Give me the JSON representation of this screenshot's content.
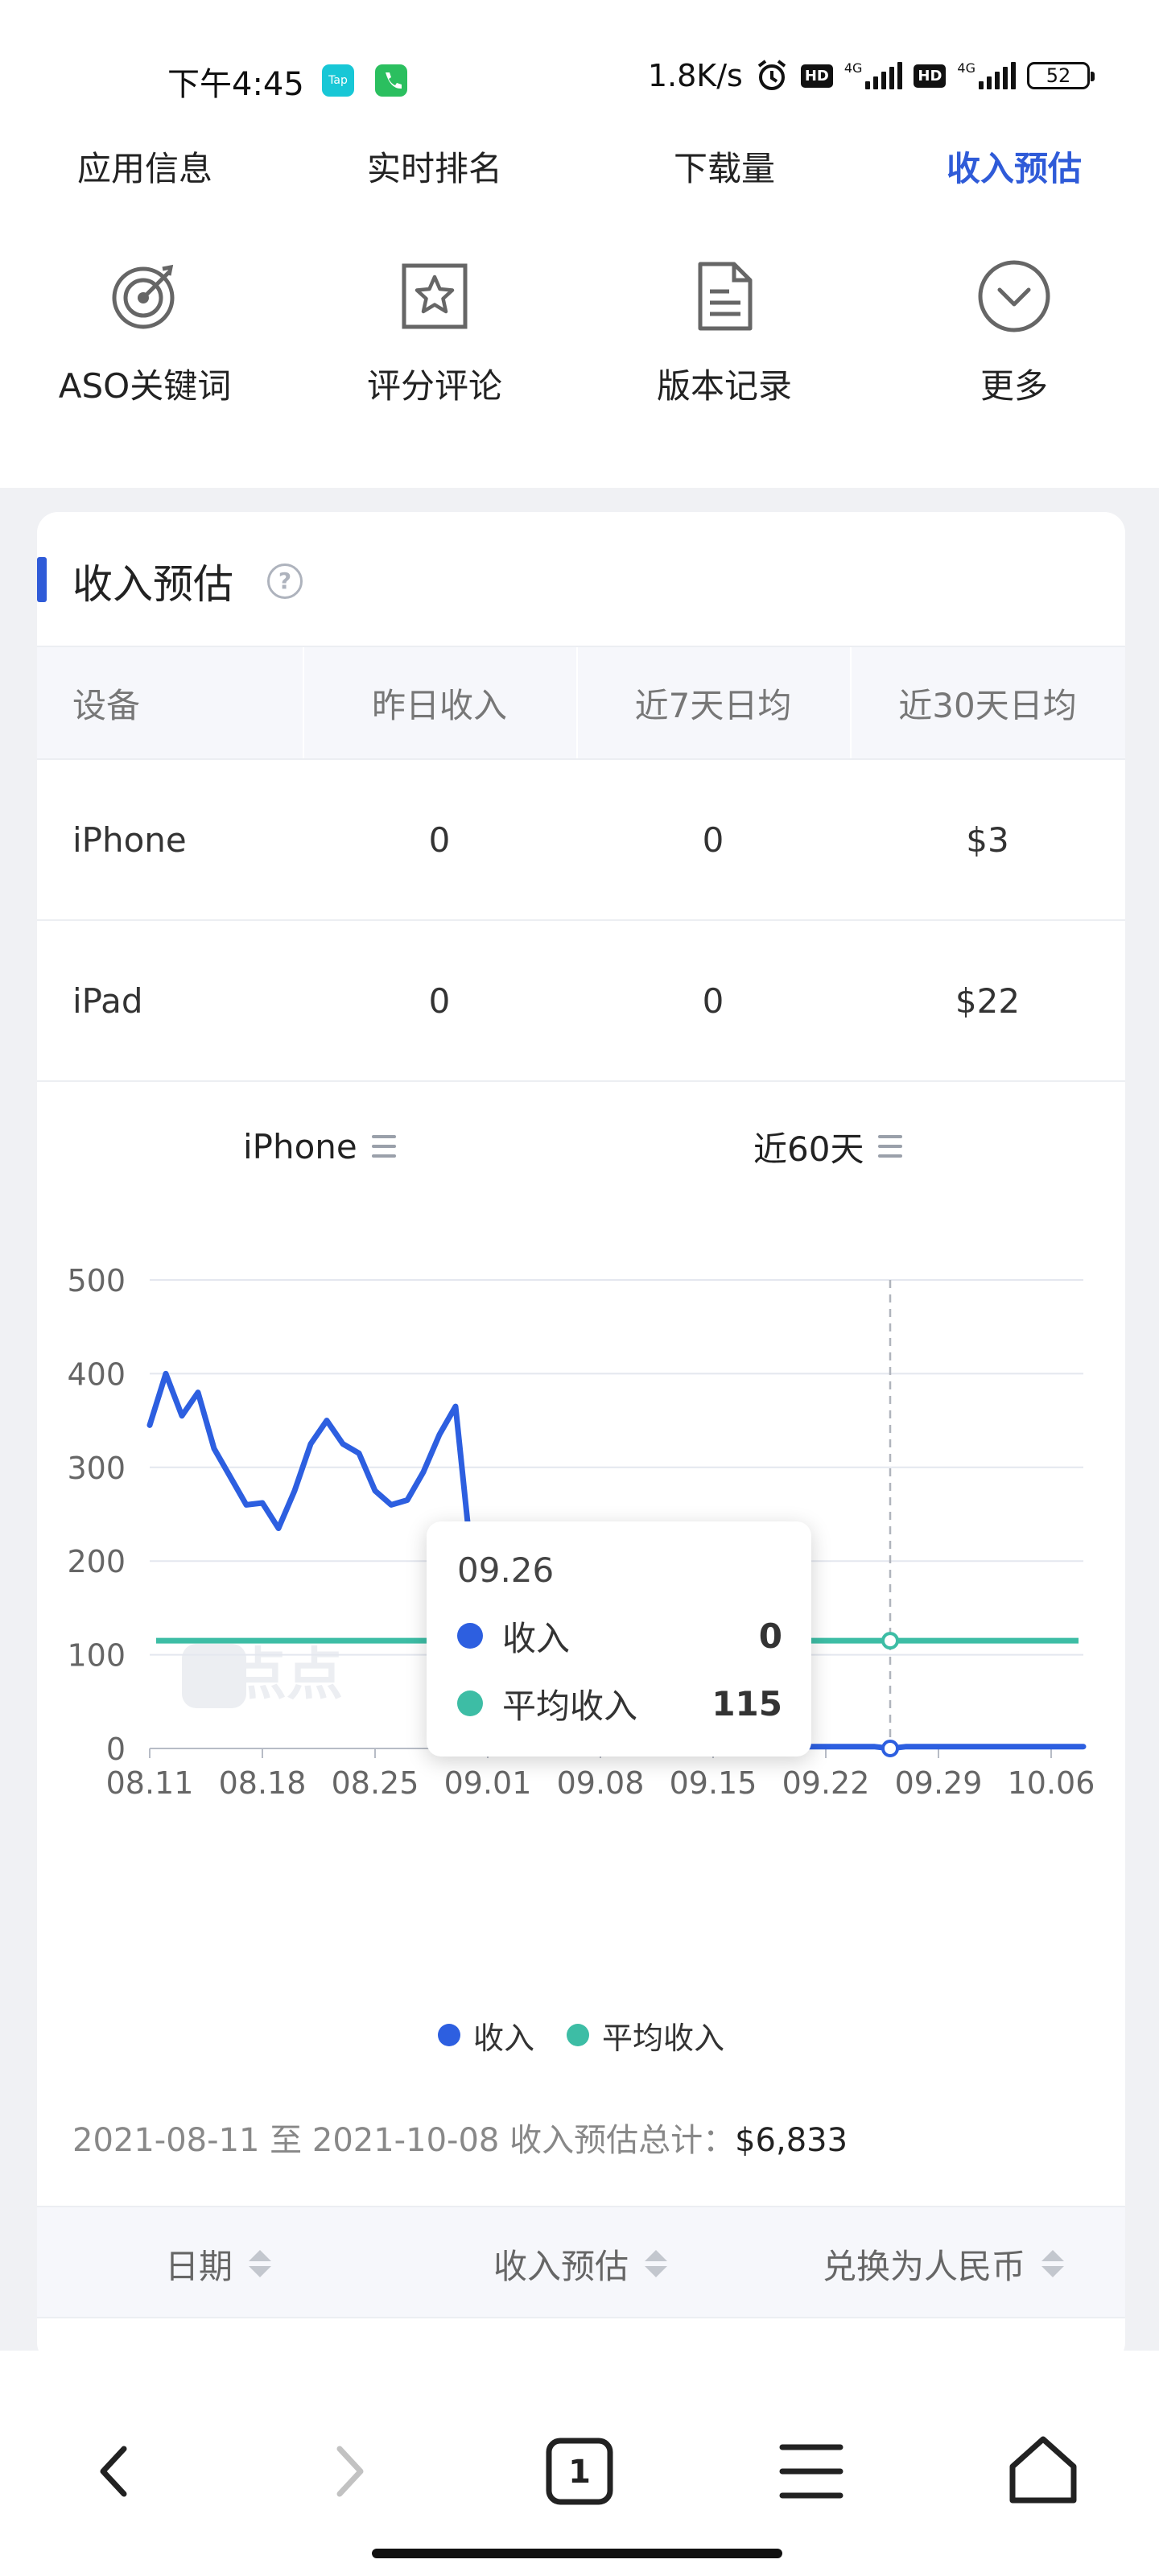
{
  "status_bar": {
    "time": "下午4:45",
    "app_icon_1": "taptap-icon",
    "app_icon_1_text": "Tap",
    "app_icon_2": "phone-icon",
    "net_speed": "1.8K/s",
    "alarm_icon": "alarm-icon",
    "hd_badge_1": "HD",
    "net_type_1": "4G",
    "hd_badge_2": "HD",
    "net_type_2": "4G",
    "battery_level": "52",
    "colors": {
      "taptap": "#18c7d6",
      "phone": "#2bbf5f"
    }
  },
  "tabs": [
    {
      "label": "应用信息"
    },
    {
      "label": "实时排名"
    },
    {
      "label": "下载量"
    },
    {
      "label": "收入预估"
    }
  ],
  "quick_entries": [
    {
      "label": "ASO关键词",
      "icon": "target-icon"
    },
    {
      "label": "评分评论",
      "icon": "star-icon"
    },
    {
      "label": "版本记录",
      "icon": "document-icon"
    },
    {
      "label": "更多",
      "icon": "chevron-down-circle-icon"
    }
  ],
  "card": {
    "title": "收入预估",
    "help_icon": "question-icon",
    "help_text": "?"
  },
  "summary_table": {
    "headers": [
      "设备",
      "昨日收入",
      "近7天日均",
      "近30天日均"
    ],
    "rows": [
      [
        "iPhone",
        "0",
        "0",
        "$3"
      ],
      [
        "iPad",
        "0",
        "0",
        "$22"
      ]
    ]
  },
  "selectors": {
    "device": "iPhone",
    "range": "近60天"
  },
  "chart_data": {
    "type": "line",
    "x_tick_labels": [
      "08.11",
      "08.18",
      "08.25",
      "09.01",
      "09.08",
      "09.15",
      "09.22",
      "09.29",
      "10.06"
    ],
    "y_tick_labels": [
      "0",
      "100",
      "200",
      "300",
      "400",
      "500"
    ],
    "ylim": [
      0,
      500
    ],
    "x_range": [
      "08.11",
      "10.08"
    ],
    "grid": true,
    "legend_position": "bottom",
    "series": [
      {
        "name": "收入",
        "color": "#2d5fe0",
        "points": [
          [
            "08.11",
            345
          ],
          [
            "08.12",
            400
          ],
          [
            "08.13",
            355
          ],
          [
            "08.14",
            380
          ],
          [
            "08.15",
            320
          ],
          [
            "08.16",
            290
          ],
          [
            "08.17",
            260
          ],
          [
            "08.18",
            262
          ],
          [
            "08.19",
            235
          ],
          [
            "08.20",
            275
          ],
          [
            "08.21",
            325
          ],
          [
            "08.22",
            350
          ],
          [
            "08.23",
            325
          ],
          [
            "08.24",
            315
          ],
          [
            "08.25",
            275
          ],
          [
            "08.26",
            260
          ],
          [
            "08.27",
            265
          ],
          [
            "08.28",
            295
          ],
          [
            "08.29",
            335
          ],
          [
            "08.30",
            365
          ],
          [
            "08.31",
            200
          ],
          [
            "09.01",
            50
          ],
          [
            "09.02",
            55
          ],
          [
            "09.03",
            55
          ],
          [
            "09.04",
            62
          ],
          [
            "09.05",
            60
          ],
          [
            "09.06",
            55
          ],
          [
            "09.07",
            55
          ],
          [
            "09.08",
            55
          ],
          [
            "09.09",
            55
          ],
          [
            "09.10",
            2
          ],
          [
            "09.11",
            2
          ],
          [
            "09.12",
            2
          ],
          [
            "09.13",
            2
          ],
          [
            "09.14",
            2
          ],
          [
            "09.15",
            2
          ],
          [
            "09.16",
            2
          ],
          [
            "09.17",
            2
          ],
          [
            "09.18",
            2
          ],
          [
            "09.19",
            2
          ],
          [
            "09.20",
            2
          ],
          [
            "09.21",
            2
          ],
          [
            "09.22",
            2
          ],
          [
            "09.23",
            2
          ],
          [
            "09.24",
            2
          ],
          [
            "09.25",
            2
          ],
          [
            "09.26",
            0
          ],
          [
            "09.27",
            2
          ],
          [
            "09.28",
            2
          ],
          [
            "09.29",
            2
          ],
          [
            "09.30",
            2
          ],
          [
            "10.01",
            2
          ],
          [
            "10.02",
            2
          ],
          [
            "10.03",
            2
          ],
          [
            "10.04",
            2
          ],
          [
            "10.05",
            2
          ],
          [
            "10.06",
            2
          ],
          [
            "10.07",
            2
          ],
          [
            "10.08",
            2
          ]
        ]
      },
      {
        "name": "平均收入",
        "color": "#3dbda5",
        "constant_value": 115
      }
    ],
    "highlight": {
      "date": "09.26",
      "收入": 0,
      "平均收入": 115
    },
    "watermark": "点点"
  },
  "tooltip": {
    "date": "09.26",
    "rows": [
      {
        "label": "收入",
        "value": "0"
      },
      {
        "label": "平均收入",
        "value": "115"
      }
    ]
  },
  "legend": [
    "收入",
    "平均收入"
  ],
  "total": {
    "prefix": "2021-08-11 至 2021-10-08 收入预估总计：",
    "value": "$6,833"
  },
  "list_headers": [
    "日期",
    "收入预估",
    "兑换为人民币"
  ],
  "bottom_nav": {
    "tab_count": "1",
    "icons": [
      "back-icon",
      "forward-icon",
      "tabs-icon",
      "menu-icon",
      "home-icon"
    ]
  },
  "colors": {
    "accent": "#2f5bd8",
    "series_revenue": "#2d5fe0",
    "series_average": "#3dbda5"
  }
}
